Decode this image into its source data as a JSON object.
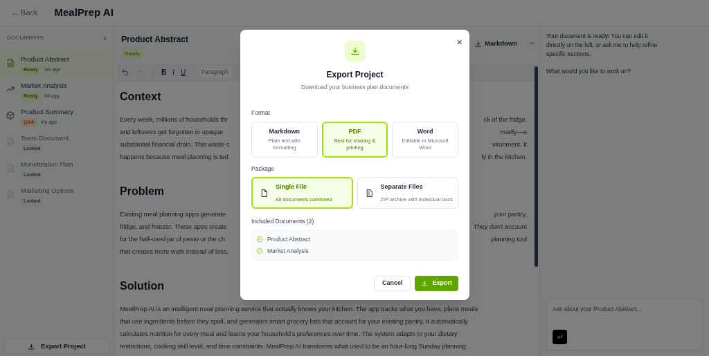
{
  "header": {
    "back": "← Back",
    "title": "MealPrep AI"
  },
  "sidebar": {
    "heading": "DOCUMENTS",
    "collapse": "‹",
    "items": [
      {
        "kind": "document",
        "title": "Product Abstract",
        "badge": {
          "kind": "ready",
          "text": "Ready"
        },
        "time": "9m ago",
        "selected": true,
        "locked": false
      },
      {
        "kind": "chart",
        "title": "Market Analysis",
        "badge": {
          "kind": "ready",
          "text": "Ready"
        },
        "time": "9d ago",
        "selected": false,
        "locked": false
      },
      {
        "kind": "cube",
        "title": "Product Summary",
        "badge": {
          "kind": "qa",
          "text": "Q&A"
        },
        "time": "4m ago",
        "selected": false,
        "locked": false
      },
      {
        "kind": "document",
        "title": "Team Document",
        "badge": {
          "kind": "locked",
          "text": "Locked"
        },
        "selected": false,
        "locked": true
      },
      {
        "kind": "document",
        "title": "Monetization Plan",
        "badge": {
          "kind": "locked",
          "text": "Locked"
        },
        "selected": false,
        "locked": true
      },
      {
        "kind": "document",
        "title": "Marketing Options",
        "badge": {
          "kind": "locked",
          "text": "Locked"
        },
        "selected": false,
        "locked": true
      }
    ],
    "export_button": "Export Project"
  },
  "editor": {
    "title": "Product Abstract",
    "status": "Ready",
    "download_format": "Markdown",
    "toolbar": {
      "bold": "B",
      "italic": "I",
      "underline": "U",
      "style": "Paragraph"
    },
    "sections": [
      {
        "heading": "Context",
        "lines": [
          {
            "left": "Every week, millions of households thr",
            "right": "ck of the fridge,"
          },
          {
            "left": "and leftovers get forgotten in opaque",
            "right": "nually—a"
          },
          {
            "left": "substantial financial drain. This waste c",
            "right": "vironment. It"
          },
          {
            "left": "happens because meal planning is ted",
            "right": "ly in the kitchen."
          }
        ]
      },
      {
        "heading": "Problem",
        "lines": [
          {
            "left": "Existing meal planning apps generate",
            "right": "your pantry,"
          },
          {
            "left": "fridge, and freezer. These apps create",
            "right": "They don't account"
          },
          {
            "left": "for the half-used jar of pesto or the ch",
            "right": "planning tool"
          },
          {
            "left": "that creates more work instead of less,"
          }
        ]
      },
      {
        "heading": "Solution",
        "lines": [
          {
            "left": "MealPrep AI is an intelligent meal planning service that actually knows your kitchen. The app tracks what you have, plans meals"
          },
          {
            "left": "that use ingredients before they spoil, and generates smart grocery lists that account for your existing pantry. It automatically"
          },
          {
            "left": "calculates nutrition for every meal and learns your household's preferences over time. The system adapts to your dietary"
          },
          {
            "left": "restrictions, cooking skill level, and time constraints. MealPrep AI transforms what used to be an hour-long Sunday planning"
          }
        ]
      }
    ]
  },
  "chat": {
    "messages": [
      "Your document is ready! You can edit it directly on the left, or ask me to help refine specific sections.",
      "What would you like to work on?"
    ],
    "input": {
      "placeholder": "Ask about your Product Abstract..."
    }
  },
  "dialog": {
    "close": "×",
    "title": "Export Project",
    "subtitle": "Download your business plan documents",
    "format_label": "Format",
    "formats": [
      {
        "title": "Markdown",
        "description": "Plain text with formatting",
        "selected": false
      },
      {
        "title": "PDF",
        "description": "Best for sharing & printing",
        "selected": true
      },
      {
        "title": "Word",
        "description": "Editable in Microsoft Word",
        "selected": false
      }
    ],
    "package_label": "Package",
    "packages": [
      {
        "kind": "single",
        "title": "Single File",
        "description": "All documents combined",
        "selected": true
      },
      {
        "kind": "separate",
        "title": "Separate Files",
        "description": "ZIP archive with individual docs",
        "selected": false
      }
    ],
    "included_label": "Included Documents (2)",
    "included": [
      "Product Abstract",
      "Market Analysis"
    ],
    "buttons": {
      "cancel": "Cancel",
      "export": "Export"
    }
  }
}
